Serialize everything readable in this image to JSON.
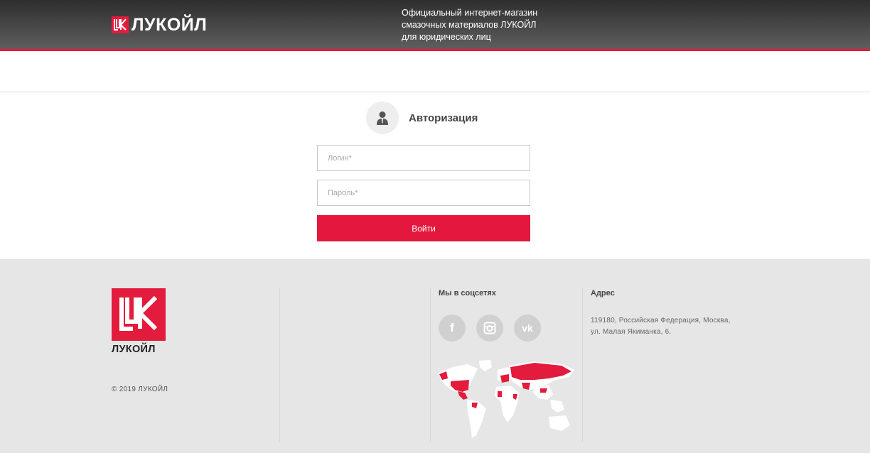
{
  "header": {
    "brand": "ЛУКОЙЛ",
    "tagline_line1": "Официальный интернет-магазин",
    "tagline_line2": "смазочных материалов ЛУКОЙЛ",
    "tagline_line3": "для юридических лиц"
  },
  "auth": {
    "title": "Авторизация",
    "login_placeholder": "Логин*",
    "login_value": "",
    "password_placeholder": "Пароль*",
    "password_value": "",
    "submit_label": "Войти"
  },
  "footer": {
    "brand": "ЛУКОЙЛ",
    "copyright": "© 2019 ЛУКОЙЛ",
    "social_title": "Мы в соцсетях",
    "social_links": [
      {
        "icon": "facebook-icon",
        "glyph": "f"
      },
      {
        "icon": "instagram-icon",
        "glyph": ""
      },
      {
        "icon": "vk-icon",
        "glyph": "vk"
      }
    ],
    "address_title": "Адрес",
    "address_line1": "119180, Российская Федерация, Москва,",
    "address_line2": "ул. Малая Якиманка, 6."
  },
  "colors": {
    "accent": "#e31b3c",
    "button": "#e4173e",
    "footer_bg": "#e6e6e7"
  }
}
